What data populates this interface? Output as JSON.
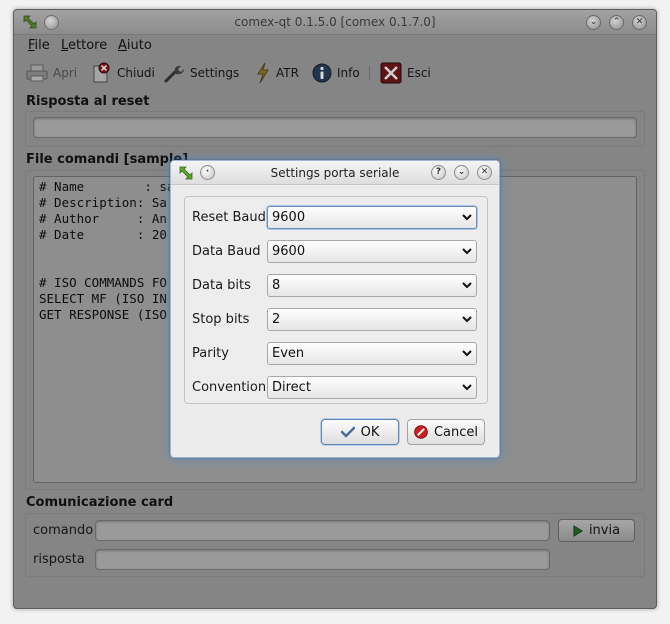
{
  "window": {
    "title": "comex-qt 0.1.5.0 [comex 0.1.7.0]"
  },
  "menu": [
    {
      "label": "File",
      "mnemonic": "F",
      "rest": "ile"
    },
    {
      "label": "Lettore",
      "mnemonic": "L",
      "rest": "ettore"
    },
    {
      "label": "Aiuto",
      "mnemonic": "A",
      "rest": "iuto"
    }
  ],
  "toolbar": {
    "apri": "Apri",
    "chiudi": "Chiudi",
    "settings": "Settings",
    "atr": "ATR",
    "info": "Info",
    "esci": "Esci"
  },
  "reset_section": {
    "label": "Risposta al reset",
    "value": ""
  },
  "commands_section": {
    "label": "File comandi [sample]",
    "lines": [
      "# Name        : sa",
      "# Description: Sa",
      "# Author     : An",
      "# Date       : 20",
      "",
      "",
      "# ISO COMMANDS FO",
      "SELECT MF (ISO IN",
      "GET RESPONSE (ISO"
    ]
  },
  "card_section": {
    "label": "Comunicazione card",
    "comando_label": "comando",
    "comando_value": "",
    "risposta_label": "risposta",
    "risposta_value": "",
    "invia_label": "invia"
  },
  "dialog": {
    "title": "Settings porta seriale",
    "fields": [
      {
        "label": "Reset Baud",
        "value": "9600"
      },
      {
        "label": "Data Baud",
        "value": "9600"
      },
      {
        "label": "Data bits",
        "value": "8"
      },
      {
        "label": "Stop bits",
        "value": "2"
      },
      {
        "label": "Parity",
        "value": "Even"
      },
      {
        "label": "Convention",
        "value": "Direct"
      }
    ],
    "ok_label": "OK",
    "cancel_label": "Cancel"
  },
  "colors": {
    "dialog_glow": "#468cd2",
    "invia_arrow": "#2e8b2e",
    "cancel_icon": "#c62020"
  },
  "icons": {
    "app": "resize-arrows-icon",
    "apri": "printer-icon",
    "chiudi": "document-close-icon",
    "settings": "wrench-icon",
    "atr": "lightning-icon",
    "info": "info-icon",
    "esci": "exit-icon"
  }
}
